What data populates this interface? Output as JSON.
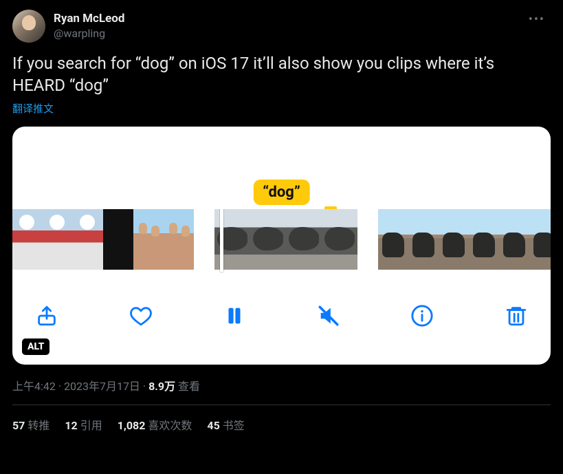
{
  "author": {
    "display_name": "Ryan McLeod",
    "handle": "@warpling"
  },
  "text": "If you search for “dog” on iOS 17 it’ll also show you clips where it’s HEARD “dog”",
  "translate_label": "翻译推文",
  "media": {
    "caption_bubble": "“dog”",
    "alt_badge": "ALT"
  },
  "meta": {
    "time": "上午4:42",
    "date": "2023年7月17日",
    "views_count": "8.9万",
    "views_label": "查看",
    "sep": " · "
  },
  "stats": {
    "retweets": {
      "count": "57",
      "label": "转推"
    },
    "quotes": {
      "count": "12",
      "label": "引用"
    },
    "likes": {
      "count": "1,082",
      "label": "喜欢次数"
    },
    "bookmarks": {
      "count": "45",
      "label": "书签"
    }
  }
}
